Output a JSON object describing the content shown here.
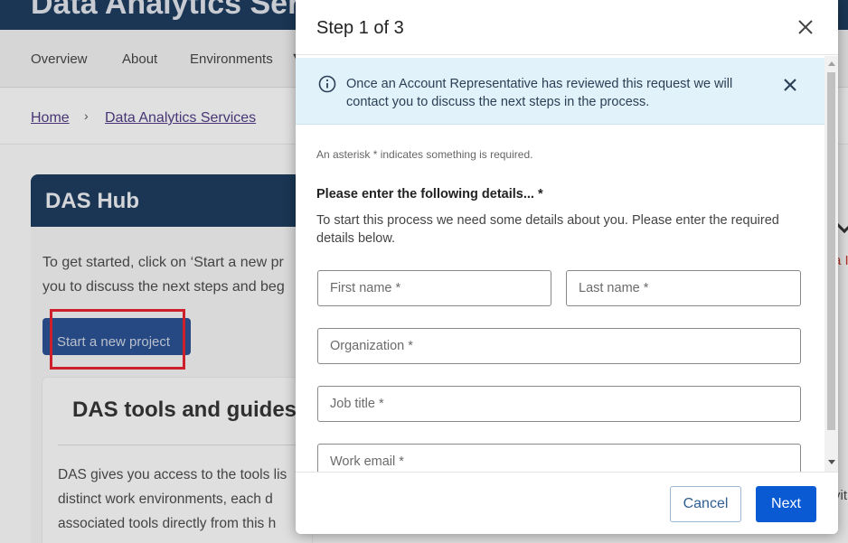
{
  "background": {
    "site_title": "Data Analytics Serv",
    "nav": [
      "Overview",
      "About",
      "Environments"
    ],
    "breadcrumb": {
      "home": "Home",
      "separator": "›",
      "current": "Data Analytics Services"
    },
    "hub": {
      "title": "DAS Hub",
      "intro_line1": "To get started, click on ‘Start a new pr",
      "intro_line2": "you to discuss the next steps and beg",
      "start_button": "Start a new project"
    },
    "tools": {
      "title": "DAS tools and guides",
      "line1": "DAS gives you access to the tools lis",
      "line2": "distinct work environments, each d",
      "line3": "associated tools directly from this h"
    },
    "right_fragments": [
      "a I",
      "vit"
    ]
  },
  "modal": {
    "title": "Step 1 of 3",
    "alert": {
      "text": "Once an Account Representative has reviewed this request we will contact you to discuss the next steps in the process."
    },
    "required_note": "An asterisk * indicates something is required.",
    "section_title": "Please enter the following details... *",
    "section_desc": "To start this process we need some details about you. Please enter the required details below.",
    "fields": {
      "first_name": "First name *",
      "last_name": "Last name *",
      "organization": "Organization *",
      "job_title": "Job title *",
      "work_email": "Work email *"
    },
    "cancel_label": "Cancel",
    "next_label": "Next"
  },
  "colors": {
    "brand_navy": "#1d3b5c",
    "primary_button": "#0a5ad4",
    "alert_bg": "#e2f2fa",
    "highlight": "#e0232f"
  },
  "icons": [
    "info-icon",
    "close-icon",
    "chevron-down-icon",
    "chevron-right-icon"
  ]
}
